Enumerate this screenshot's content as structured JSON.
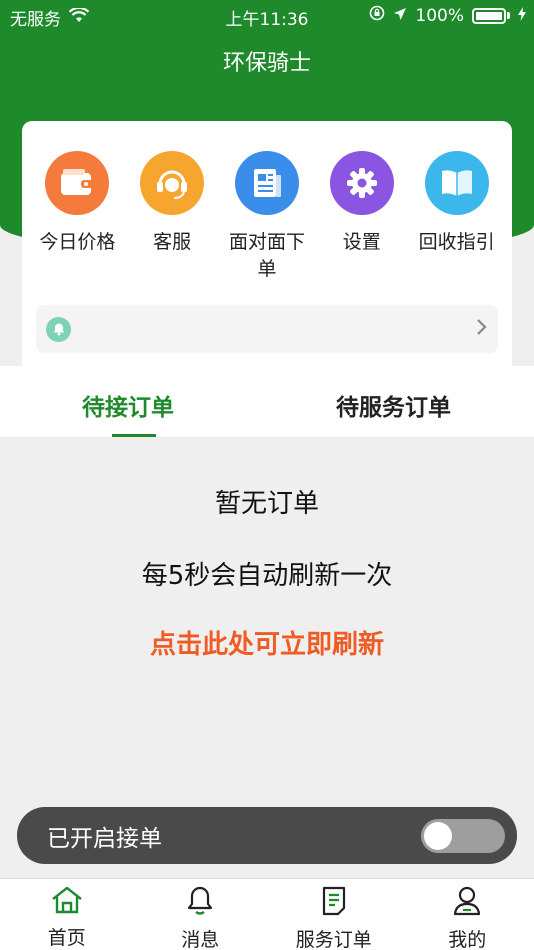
{
  "status_bar": {
    "carrier": "无服务",
    "time": "上午11:36",
    "battery": "100%"
  },
  "nav": {
    "title": "环保骑士"
  },
  "features": [
    {
      "label": "今日价格",
      "icon": "wallet-icon",
      "color": "#f47b3c"
    },
    {
      "label": "客服",
      "icon": "headset-icon",
      "color": "#f6a52e"
    },
    {
      "label": "面对面下单",
      "icon": "newspaper-icon",
      "color": "#3a8de8"
    },
    {
      "label": "设置",
      "icon": "gear-icon",
      "color": "#8a55e0"
    },
    {
      "label": "回收指引",
      "icon": "book-icon",
      "color": "#3cb7ec"
    }
  ],
  "notice": {
    "text": ""
  },
  "tabs": {
    "pending": "待接订单",
    "service": "待服务订单"
  },
  "empty_state": {
    "title": "暂无订单",
    "subtitle": "每5秒会自动刷新一次",
    "refresh": "点击此处可立即刷新"
  },
  "accept_toggle": {
    "label": "已开启接单",
    "on": false
  },
  "tabbar": [
    {
      "label": "首页",
      "icon": "home-icon"
    },
    {
      "label": "消息",
      "icon": "bell-icon"
    },
    {
      "label": "服务订单",
      "icon": "document-icon"
    },
    {
      "label": "我的",
      "icon": "user-icon"
    }
  ],
  "colors": {
    "brand_green": "#1e8a2c",
    "refresh_orange": "#f05a24"
  }
}
